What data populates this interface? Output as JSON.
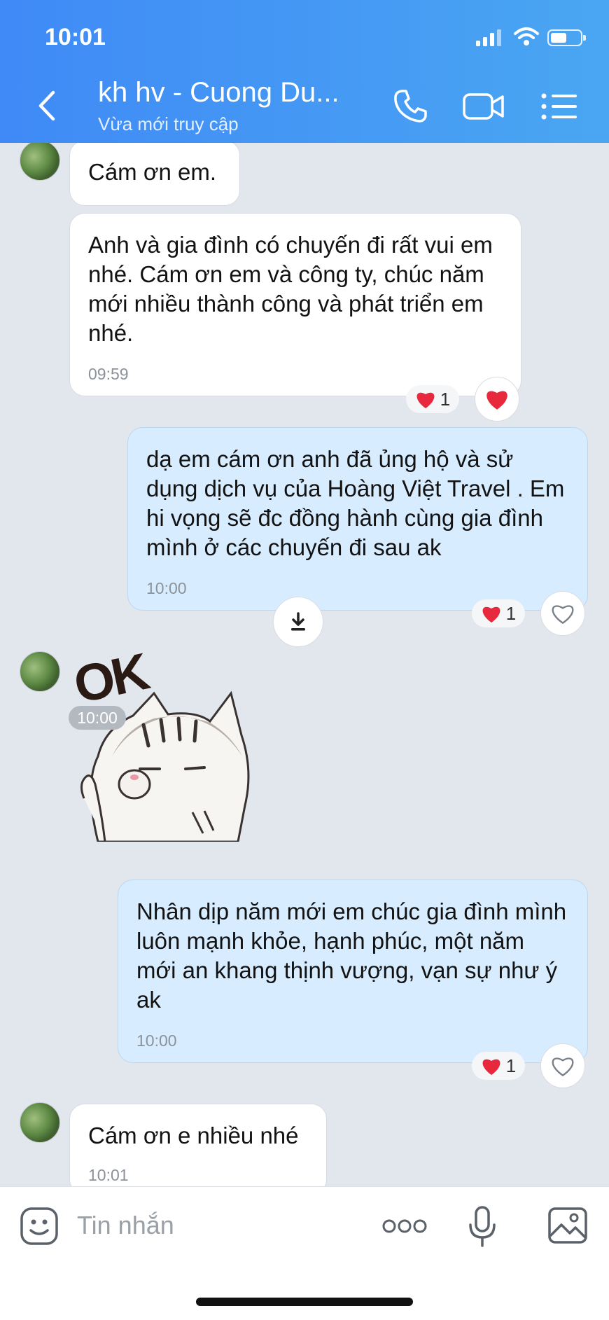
{
  "status_bar": {
    "time": "10:01"
  },
  "header": {
    "title": "kh hv - Cuong Du...",
    "subtitle": "Vừa mới truy cập",
    "accent": "#4396f4"
  },
  "messages": {
    "m1": {
      "text": "Cám ơn em."
    },
    "m2": {
      "text": "Anh và gia đình có chuyến đi rất vui em nhé. Cám ơn em và công ty, chúc năm mới nhiều thành công và phát triển em nhé.",
      "time": "09:59",
      "reaction_count": "1"
    },
    "m3": {
      "text": "dạ em cám ơn anh đã ủng hộ và sử dụng dịch vụ của Hoàng Việt Travel . Em hi vọng sẽ đc đồng hành cùng gia đình mình ở các chuyến đi sau ak",
      "time": "10:00",
      "reaction_count": "1"
    },
    "sticker": {
      "text": "OK",
      "time": "10:00"
    },
    "m4": {
      "text": "Nhân dịp năm mới em chúc gia đình mình luôn mạnh khỏe, hạnh phúc, một năm mới an khang thịnh vượng, vạn sự như ý ak",
      "time": "10:00",
      "reaction_count": "1"
    },
    "m5": {
      "text": "Cám ơn e nhiều nhé",
      "time": "10:01"
    }
  },
  "composer": {
    "placeholder": "Tin nhắn"
  },
  "colors": {
    "heart": "#e8283c",
    "outgoing_bubble": "#d8ecff",
    "incoming_bubble": "#ffffff"
  }
}
